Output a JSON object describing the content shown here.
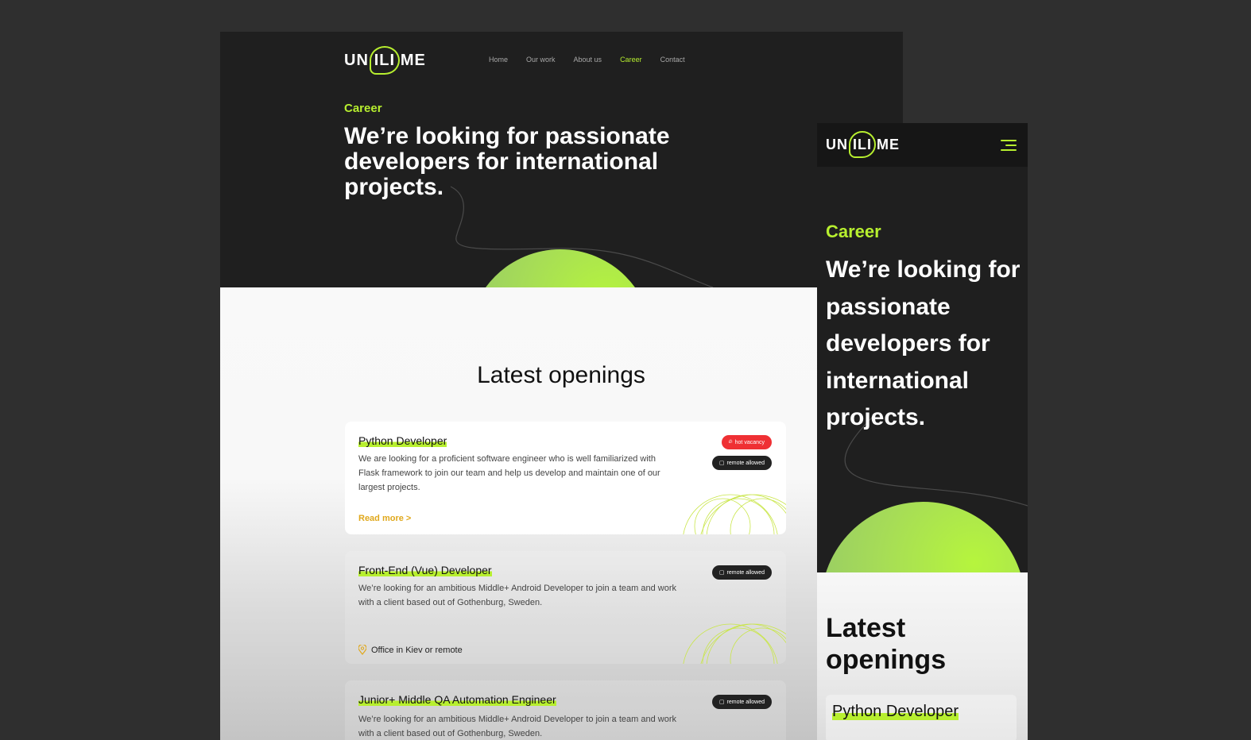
{
  "brand": {
    "logo_left": "UN",
    "logo_mid": "ILI",
    "logo_right": "ME"
  },
  "nav": {
    "items": [
      "Home",
      "Our work",
      "About us",
      "Career",
      "Contact"
    ],
    "active": "Career"
  },
  "hero": {
    "kicker": "Career",
    "title": "We’re looking for passionate developers for international projects."
  },
  "openings": {
    "heading": "Latest openings",
    "items": [
      {
        "title": "Python Developer",
        "description": "We are looking for a proficient software engineer who is well familiarized with Flask framework to join our team and help us develop and maintain one of our largest projects.",
        "link": "Read more >",
        "badge_hot": "hot vacancy",
        "badge_remote": "remote allowed"
      },
      {
        "title": "Front-End (Vue) Developer",
        "description": "We’re looking for an ambitious Middle+ Android Developer to join a team and work with a client based out of Gothenburg, Sweden.",
        "location": "Office in Kiev or remote",
        "badge_remote": "remote allowed"
      },
      {
        "title": "Junior+ Middle QA Automation Engineer",
        "description": "We’re looking for an ambitious Middle+ Android Developer to join a team and work with a client based out of Gothenburg, Sweden.",
        "badge_remote": "remote allowed"
      }
    ]
  },
  "mobile": {
    "kicker": "Career",
    "title": "We’re looking for passionate developers for international projects.",
    "heading": "Latest openings",
    "first_opening": "Python Developer"
  },
  "colors": {
    "accent": "#b7ef2f",
    "hot": "#ef3034",
    "link": "#e0a81c",
    "dark": "#1f1f1f"
  },
  "icons": [
    "fire-icon",
    "monitor-icon",
    "location-pin-icon",
    "hamburger-menu-icon"
  ]
}
